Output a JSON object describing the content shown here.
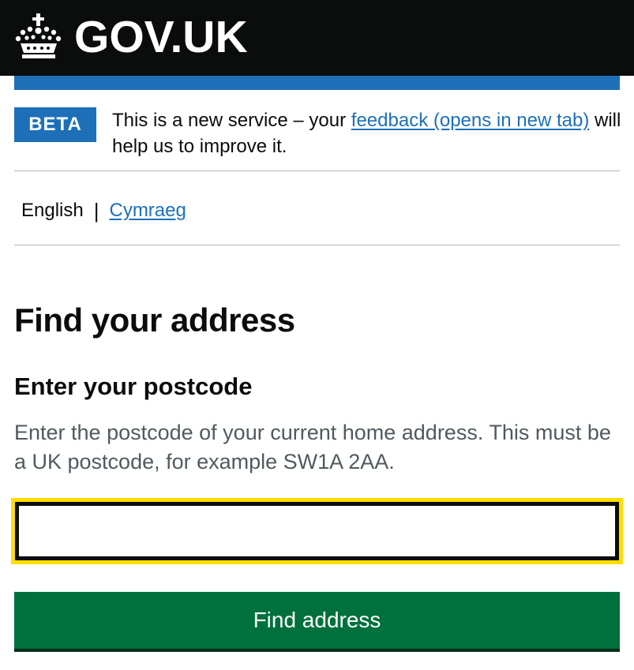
{
  "header": {
    "logo_text": "GOV.UK",
    "logo_icon": "crown-icon",
    "background": "#0b0c0c"
  },
  "phase_banner": {
    "tag": "BETA",
    "text_before": "This is a new service – your ",
    "link_text": "feedback (opens in new tab)",
    "text_after": " will help us to improve it."
  },
  "language": {
    "current": "English",
    "separator": "|",
    "alternative": "Cymraeg"
  },
  "main": {
    "heading": "Find your address",
    "field_label": "Enter your postcode",
    "hint": "Enter the postcode of your current home address. This must be a UK postcode, for example SW1A 2AA.",
    "input_value": "",
    "button_label": "Find address"
  },
  "colors": {
    "brand_blue": "#1d70b8",
    "button_green": "#00703c",
    "focus_yellow": "#ffdd00"
  }
}
